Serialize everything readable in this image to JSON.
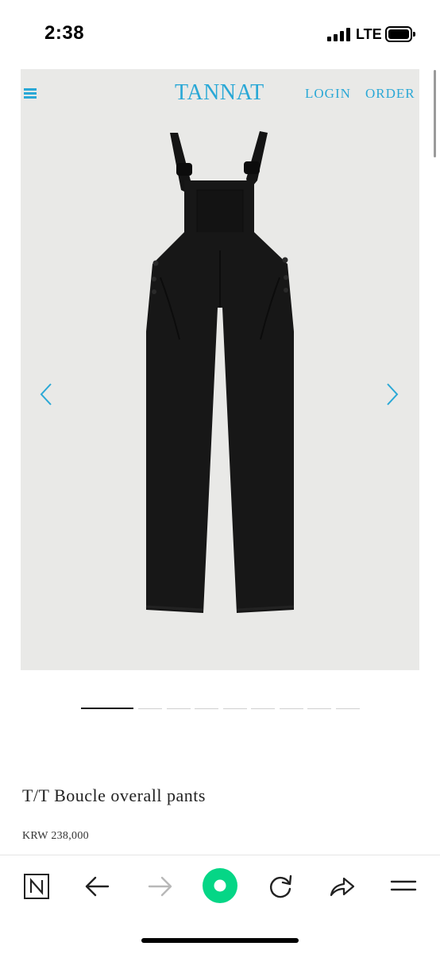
{
  "status_bar": {
    "time": "2:38",
    "network": "LTE",
    "icons": [
      "signal-icon",
      "battery-icon"
    ]
  },
  "header": {
    "brand": "TANNAT",
    "login": "LOGIN",
    "order": "ORDER",
    "icons": [
      "menu-icon"
    ]
  },
  "gallery": {
    "image": "black boucle overall pants on light grey background",
    "icons": [
      "chevron-left-icon",
      "chevron-right-icon"
    ],
    "slide_count": 10,
    "active_slide": 1
  },
  "product": {
    "title": "T/T Boucle overall pants",
    "price": "KRW 238,000"
  },
  "browser_toolbar": {
    "icons": [
      "naver-n-icon",
      "back-arrow-icon",
      "forward-arrow-icon",
      "green-dot-icon",
      "reload-icon",
      "share-icon",
      "hamburger-icon"
    ]
  },
  "colors": {
    "accent": "#2aa8d6",
    "image_background": "#e9e9e7",
    "garment": "#161616",
    "green_button": "#05d686",
    "text": "#222222"
  }
}
